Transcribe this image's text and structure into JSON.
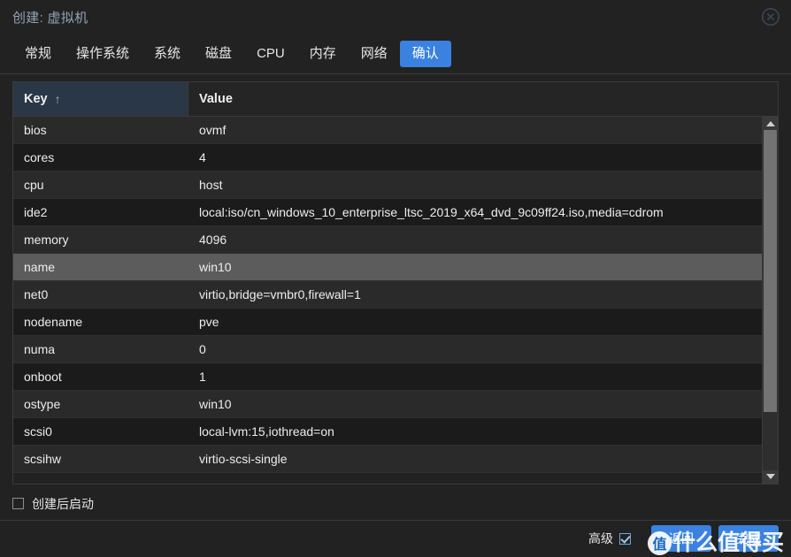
{
  "dialog": {
    "title": "创建: 虚拟机",
    "close_icon": "close-circle-icon"
  },
  "tabs": [
    {
      "label": "常规",
      "active": false
    },
    {
      "label": "操作系统",
      "active": false
    },
    {
      "label": "系统",
      "active": false
    },
    {
      "label": "磁盘",
      "active": false
    },
    {
      "label": "CPU",
      "active": false
    },
    {
      "label": "内存",
      "active": false
    },
    {
      "label": "网络",
      "active": false
    },
    {
      "label": "确认",
      "active": true
    }
  ],
  "grid": {
    "columns": [
      {
        "label": "Key",
        "sorted": true,
        "sort_arrow": "↑"
      },
      {
        "label": "Value",
        "sorted": false,
        "sort_arrow": ""
      }
    ],
    "rows": [
      {
        "key": "bios",
        "value": "ovmf",
        "selected": false
      },
      {
        "key": "cores",
        "value": "4",
        "selected": false
      },
      {
        "key": "cpu",
        "value": "host",
        "selected": false
      },
      {
        "key": "ide2",
        "value": "local:iso/cn_windows_10_enterprise_ltsc_2019_x64_dvd_9c09ff24.iso,media=cdrom",
        "selected": false
      },
      {
        "key": "memory",
        "value": "4096",
        "selected": false
      },
      {
        "key": "name",
        "value": "win10",
        "selected": true
      },
      {
        "key": "net0",
        "value": "virtio,bridge=vmbr0,firewall=1",
        "selected": false
      },
      {
        "key": "nodename",
        "value": "pve",
        "selected": false
      },
      {
        "key": "numa",
        "value": "0",
        "selected": false
      },
      {
        "key": "onboot",
        "value": "1",
        "selected": false
      },
      {
        "key": "ostype",
        "value": "win10",
        "selected": false
      },
      {
        "key": "scsi0",
        "value": "local-lvm:15,iothread=on",
        "selected": false
      },
      {
        "key": "scsihw",
        "value": "virtio-scsi-single",
        "selected": false
      }
    ],
    "scrollbar": {
      "up_icon": "caret-up-icon",
      "down_icon": "caret-down-icon",
      "thumb_fraction": 0.83
    }
  },
  "footer": {
    "start_after_create": {
      "label": "创建后启动",
      "checked": false
    },
    "advanced": {
      "label": "高级",
      "checked": true
    },
    "back_button": "返回",
    "finish_button": "完成"
  },
  "watermark": {
    "badge": "值",
    "text": "什么值得买"
  },
  "colors": {
    "accent": "#3a81e0",
    "title": "#94a3b8",
    "key_header_bg": "#2a3747",
    "selected_row_bg": "#5c5c5c",
    "row_odd_bg": "#2a2a2a",
    "row_even_bg": "#1b1b1b",
    "dialog_bg": "#222222"
  }
}
